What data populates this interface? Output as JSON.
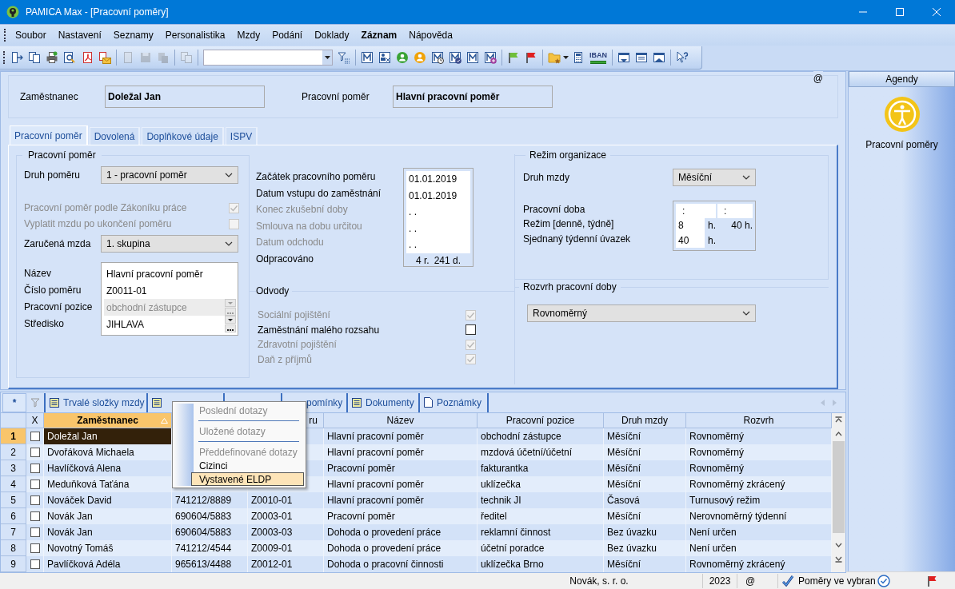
{
  "window": {
    "title": "PAMICA Max - [Pracovní poměry]"
  },
  "menu": [
    {
      "label": "Soubor",
      "bold": false
    },
    {
      "label": "Nastavení",
      "bold": false
    },
    {
      "label": "Seznamy",
      "bold": false
    },
    {
      "label": "Personalistika",
      "bold": false
    },
    {
      "label": "Mzdy",
      "bold": false
    },
    {
      "label": "Podání",
      "bold": false
    },
    {
      "label": "Doklady",
      "bold": false
    },
    {
      "label": "Záznam",
      "bold": true
    },
    {
      "label": "Nápověda",
      "bold": false
    }
  ],
  "toolbar": {
    "iban_label": "IBAN"
  },
  "header": {
    "employee_label": "Zaměstnanec",
    "employee": "Doležal Jan",
    "relation_label": "Pracovní poměr",
    "relation": "Hlavní pracovní poměr",
    "at_sign": "@"
  },
  "tabs": [
    {
      "label": "Pracovní poměr",
      "selected": true
    },
    {
      "label": "Dovolená",
      "selected": false
    },
    {
      "label": "Doplňkové údaje",
      "selected": false
    },
    {
      "label": "ISPV",
      "selected": false
    }
  ],
  "employment": {
    "title": "Pracovní poměr",
    "type": {
      "label": "Druh poměru",
      "value": "1 - pracovní poměr"
    },
    "checks": [
      {
        "label": "Pracovní poměr podle Zákoníku práce",
        "checked": true,
        "disabled": true
      },
      {
        "label": "Vyplatit mzdu po ukončení poměru",
        "checked": false,
        "disabled": true
      }
    ],
    "guaranteed_wage": {
      "label": "Zaručená mzda",
      "value": "1. skupina"
    },
    "details": [
      {
        "label": "Název",
        "value": "Hlavní pracovní poměr",
        "kind": "text",
        "disabled": false
      },
      {
        "label": "Číslo poměru",
        "value": "Z0011-01",
        "kind": "text",
        "disabled": false
      },
      {
        "label": "Pracovní pozice",
        "value": "obchodní zástupce",
        "kind": "lookup",
        "disabled": true
      },
      {
        "label": "Středisko",
        "value": "JIHLAVA",
        "kind": "lookup",
        "disabled": false
      }
    ]
  },
  "dates": [
    {
      "label": "Začátek pracovního poměru",
      "value": "01.01.2019",
      "disabled": false
    },
    {
      "label": "Datum vstupu do zaměstnání",
      "value": "01.01.2019",
      "disabled": false
    },
    {
      "label": "Konec zkušební doby",
      "value": ". .",
      "disabled": true
    },
    {
      "label": "Smlouva na dobu určitou",
      "value": ". .",
      "disabled": true
    },
    {
      "label": "Datum odchodu",
      "value": ". .",
      "disabled": true
    }
  ],
  "worked": {
    "label": "Odpracováno",
    "years": "4 r.",
    "days": "241 d."
  },
  "deductions": {
    "title": "Odvody",
    "items": [
      {
        "label": "Sociální pojištění",
        "checked": true,
        "disabled": true
      },
      {
        "label": "Zaměstnání malého rozsahu",
        "checked": false,
        "disabled": false
      },
      {
        "label": "Zdravotní pojištění",
        "checked": true,
        "disabled": true
      },
      {
        "label": "Daň z příjmů",
        "checked": true,
        "disabled": true
      }
    ]
  },
  "organization": {
    "title": "Režim organizace",
    "wage_type": {
      "label": "Druh mzdy",
      "value": "Měsíční"
    },
    "working_time": {
      "label": "Pracovní doba",
      "from": ":",
      "to": ":"
    },
    "regime": {
      "label": "Režim [denně, týdně]",
      "daily": "8",
      "daily_unit": "h.",
      "weekly": "40 h."
    },
    "weekly_load": {
      "label": "Sjednaný týdenní úvazek",
      "value": "40",
      "unit": "h."
    }
  },
  "schedule": {
    "title": "Rozvrh pracovní doby",
    "value": "Rovnoměrný"
  },
  "agendas": {
    "title": "Agendy",
    "item": "Pracovní poměry"
  },
  "bottom_tabs": {
    "new_label": "*",
    "tabs": [
      {
        "label": "Trvalé složky mzdy",
        "selected": false
      },
      {
        "selected": false
      },
      {
        "selected": false
      },
      {
        "label": "pomínky",
        "selected": false
      },
      {
        "label": "Dokumenty",
        "selected": false
      },
      {
        "label": "Poznámky",
        "selected": false
      }
    ]
  },
  "table": {
    "check_column": "X",
    "columns": [
      {
        "label": "Zaměstnanec",
        "sorted": true
      },
      {},
      {
        "label": "ru",
        "sorted": false
      },
      {
        "label": "Název",
        "sorted": false
      },
      {
        "label": "Pracovní pozice",
        "sorted": false
      },
      {
        "label": "Druh mzdy",
        "sorted": false
      },
      {
        "label": "Rozvrh",
        "sorted": false
      }
    ],
    "rows": [
      {
        "number": "1",
        "selected": true,
        "checked": false,
        "cells": [
          "Doležal Jan",
          "",
          "",
          "Hlavní pracovní poměr",
          "obchodní zástupce",
          "Měsíční",
          "Rovnoměrný"
        ]
      },
      {
        "number": "2",
        "selected": false,
        "checked": false,
        "cells": [
          "Dvořáková Michaela",
          "",
          "",
          "Hlavní pracovní poměr",
          "mzdová účetní/účetní",
          "Měsíční",
          "Rovnoměrný"
        ]
      },
      {
        "number": "3",
        "selected": false,
        "checked": false,
        "cells": [
          "Havlíčková Alena",
          "",
          "",
          "Pracovní poměr",
          "fakturantka",
          "Měsíční",
          "Rovnoměrný"
        ]
      },
      {
        "number": "4",
        "selected": false,
        "checked": false,
        "cells": [
          "Meduňková Taťána",
          "",
          "",
          "Hlavní pracovní poměr",
          "uklízečka",
          "Měsíční",
          "Rovnoměrný zkrácený"
        ]
      },
      {
        "number": "5",
        "selected": false,
        "checked": false,
        "cells": [
          "Nováček David",
          "741212/8889",
          "Z0010-01",
          "Hlavní pracovní poměr",
          "technik JI",
          "Časová",
          "Turnusový režim"
        ]
      },
      {
        "number": "6",
        "selected": false,
        "checked": false,
        "cells": [
          "Novák Jan",
          "690604/5883",
          "Z0003-01",
          "Pracovní poměr",
          "ředitel",
          "Měsíční",
          "Nerovnoměrný týdenní"
        ]
      },
      {
        "number": "7",
        "selected": false,
        "checked": false,
        "cells": [
          "Novák Jan",
          "690604/5883",
          "Z0003-03",
          "Dohoda o provedení práce",
          "reklamní činnost",
          "Bez úvazku",
          "Není určen"
        ]
      },
      {
        "number": "8",
        "selected": false,
        "checked": false,
        "cells": [
          "Novotný Tomáš",
          "741212/4544",
          "Z0009-01",
          "Dohoda o provedení práce",
          "účetní poradce",
          "Bez úvazku",
          "Není určen"
        ]
      },
      {
        "number": "9",
        "selected": false,
        "checked": false,
        "cells": [
          "Pavlíčková Adéla",
          "965613/4488",
          "Z0012-01",
          "Dohoda o pracovní činnosti",
          "uklízečka Brno",
          "Měsíční",
          "Rovnoměrný zkrácený"
        ]
      }
    ]
  },
  "context_menu": {
    "items": [
      {
        "kind": "item",
        "label": "Poslední dotazy",
        "disabled": true,
        "selected": false
      },
      {
        "kind": "separator"
      },
      {
        "kind": "item",
        "label": "Uložené dotazy",
        "disabled": true,
        "selected": false
      },
      {
        "kind": "separator"
      },
      {
        "kind": "item",
        "label": "Předdefinované dotazy",
        "disabled": true,
        "selected": false
      },
      {
        "kind": "item",
        "label": "Cizinci",
        "disabled": false,
        "selected": false
      },
      {
        "kind": "item",
        "label": "Vystavené ELDP",
        "disabled": false,
        "selected": true
      }
    ]
  },
  "status_bar": {
    "company": "Novák, s. r. o.",
    "year": "2023",
    "at_sign": "@",
    "filter": "Poměry ve vybran"
  }
}
